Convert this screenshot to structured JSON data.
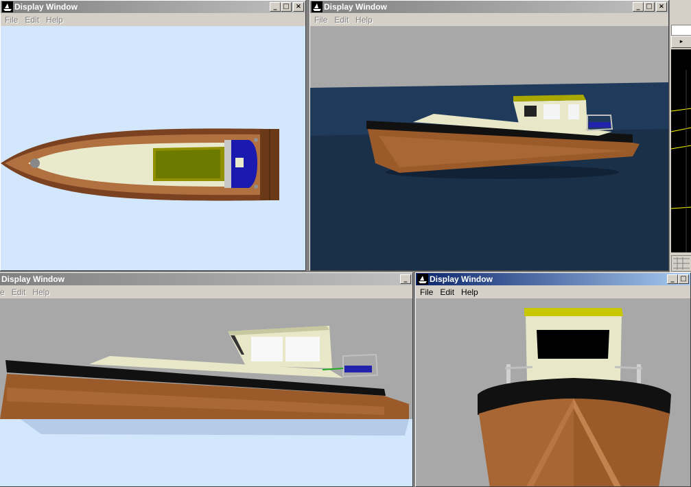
{
  "windows": {
    "top_left": {
      "title": "Display Window",
      "menu": [
        "File",
        "Edit",
        "Help"
      ],
      "view": "top"
    },
    "top_right": {
      "title": "Display Window",
      "menu": [
        "File",
        "Edit",
        "Help"
      ],
      "view": "perspective"
    },
    "bottom_left": {
      "title": "Display Window",
      "menu": [
        "",
        "Edit",
        "Help"
      ],
      "menu_first_fragment": "e",
      "view": "side"
    },
    "bottom_right": {
      "title": "Display Window",
      "menu": [
        "File",
        "Edit",
        "Help"
      ],
      "view": "front"
    }
  },
  "icons": {
    "app_icon": "boat-app-icon",
    "minimize": "minimize-icon",
    "maximize": "maximize-icon",
    "close": "close-icon"
  },
  "colors": {
    "active_title": "#0a246a",
    "inactive_title": "#808080",
    "sky_light": "#d2e6fc",
    "sea": "#1c3550",
    "hull_wood": "#8a5326",
    "deck": "#eeeed0",
    "hull_black": "#111111",
    "canopy": "#c8c800"
  }
}
